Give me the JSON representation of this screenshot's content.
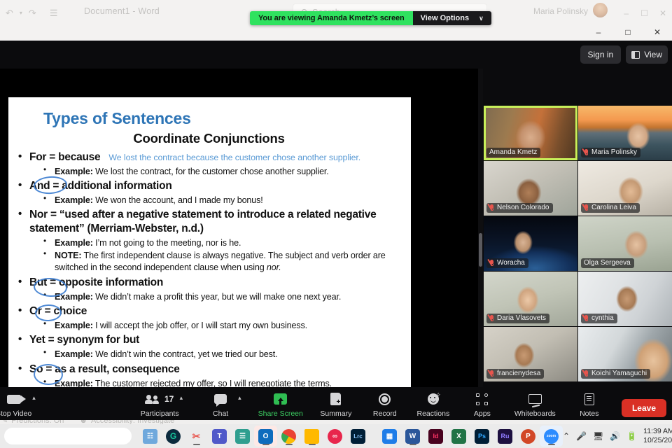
{
  "word": {
    "title": "Document1  -  Word",
    "search_placeholder": "Search",
    "account_name": "Maria Polinsky",
    "qat": [
      "undo-icon",
      "redo-icon",
      "save-icon",
      "ribbon-display-icon"
    ],
    "window_controls": {
      "minimize": "–",
      "maximize": "☐",
      "close": "✕"
    },
    "status": [
      {
        "icon": "predictions-icon",
        "label": "Predictions: On"
      },
      {
        "icon": "accessibility-icon",
        "label": "Accessibility: Investigate"
      }
    ]
  },
  "share_banner": {
    "message": "You are viewing Amanda Kmetz’s screen",
    "options_label": "View Options",
    "chevron": "∨",
    "green": "#2fe25f"
  },
  "zoom": {
    "window_controls": {
      "minimize": "–",
      "maximize": "□",
      "close": "✕"
    },
    "sign_in": "Sign in",
    "view_label": "View",
    "accent_green": "#3ccf62",
    "leave_red": "#d93025",
    "active_speaker_border": "#c8f05a"
  },
  "slide": {
    "title": "Types of Sentences",
    "subtitle": "Coordinate Conjunctions",
    "title_color": "#2e75b6",
    "items": [
      {
        "level": 1,
        "text": "For = because",
        "inline_note": "We lost the contract because the customer chose another supplier.",
        "circled": false
      },
      {
        "level": 2,
        "bold": "Example:",
        "text": " We lost the contract, for the customer chose another supplier."
      },
      {
        "level": 1,
        "text": "And = additional information",
        "circled": true
      },
      {
        "level": 2,
        "bold": "Example:",
        "text": " We won the account, and I made my bonus!"
      },
      {
        "level": 1,
        "text": "Nor = “used after a negative statement to introduce a related negative statement” (Merriam-Webster, n.d.)",
        "circled": false
      },
      {
        "level": 2,
        "bold": "Example:",
        "text": " I’m not going to the meeting, nor is he."
      },
      {
        "level": 2,
        "bold": "NOTE:",
        "text": " The first independent clause is always negative. The subject and verb order are switched in the second independent clause when using ",
        "italic_tail": "nor."
      },
      {
        "level": 1,
        "text": "But = opposite information",
        "circled": true
      },
      {
        "level": 2,
        "bold": "Example:",
        "text": " We didn’t make a profit this year, but we will make one next year."
      },
      {
        "level": 1,
        "text": "Or = choice",
        "circled": true
      },
      {
        "level": 2,
        "bold": "Example:",
        "text": " I will accept the job offer, or I will start my own business."
      },
      {
        "level": 1,
        "text": "Yet = synonym for but",
        "circled": false
      },
      {
        "level": 2,
        "bold": "Example:",
        "text": " We didn’t win the contract, yet we tried our best."
      },
      {
        "level": 1,
        "text": "So = as a result, consequence",
        "circled": true
      },
      {
        "level": 2,
        "bold": "Example:",
        "text": " The customer rejected my offer, so I will renegotiate the terms."
      }
    ]
  },
  "gallery": {
    "participants": [
      {
        "name": "Amanda Kmetz",
        "muted": false,
        "active_speaker": true
      },
      {
        "name": "Maria Polinsky",
        "muted": true,
        "active_speaker": false
      },
      {
        "name": "Nelson Colorado",
        "muted": true,
        "active_speaker": false
      },
      {
        "name": "Carolina Leiva",
        "muted": true,
        "active_speaker": false
      },
      {
        "name": "Woracha",
        "muted": true,
        "active_speaker": false
      },
      {
        "name": "Olga Sergeeva",
        "muted": false,
        "active_speaker": false
      },
      {
        "name": "Daria Vlasovets",
        "muted": true,
        "active_speaker": false
      },
      {
        "name": "cynthia",
        "muted": true,
        "active_speaker": false
      },
      {
        "name": "francienydesa",
        "muted": true,
        "active_speaker": false
      },
      {
        "name": "Koichi Yamaguchi",
        "muted": true,
        "active_speaker": false
      }
    ]
  },
  "toolbar": {
    "video_label": "Stop Video",
    "participants_label": "Participants",
    "participants_count": "17",
    "chat_label": "Chat",
    "share_label": "Share Screen",
    "summary_label": "Summary",
    "record_label": "Record",
    "reactions_label": "Reactions",
    "apps_label": "Apps",
    "whiteboards_label": "Whiteboards",
    "notes_label": "Notes",
    "leave_label": "Leave",
    "caret": "⌃"
  },
  "taskbar": {
    "search_placeholder": "",
    "apps": [
      {
        "name": "calculator",
        "glyph": "",
        "color": "#5b9bd5"
      },
      {
        "name": "grammarly",
        "glyph": "G",
        "color": "#15c39a"
      },
      {
        "name": "snipping-tool",
        "glyph": "",
        "color": "#e8554d"
      },
      {
        "name": "microsoft-teams",
        "glyph": "",
        "color": "#5059c9"
      },
      {
        "name": "sticky-notes",
        "glyph": "",
        "color": "#2f9e8f"
      },
      {
        "name": "outlook",
        "glyph": "O",
        "color": "#0f6cbd"
      },
      {
        "name": "google-chrome",
        "glyph": "",
        "color": "#4285f4"
      },
      {
        "name": "file-explorer",
        "glyph": "",
        "color": "#ffb900"
      },
      {
        "name": "nero",
        "glyph": "",
        "color": "#e8264c"
      },
      {
        "name": "lightroom-classic",
        "glyph": "Lrc",
        "color": "#001e36"
      },
      {
        "name": "trello",
        "glyph": "",
        "color": "#1f7de8"
      },
      {
        "name": "microsoft-word",
        "glyph": "W",
        "color": "#2b579a"
      },
      {
        "name": "indesign",
        "glyph": "Id",
        "color": "#49021f"
      },
      {
        "name": "microsoft-excel",
        "glyph": "X",
        "color": "#217346"
      },
      {
        "name": "photoshop",
        "glyph": "Ps",
        "color": "#001e36"
      },
      {
        "name": "rush",
        "glyph": "Ru",
        "color": "#1d1040"
      },
      {
        "name": "powerpoint",
        "glyph": "P",
        "color": "#d24726"
      },
      {
        "name": "zoom",
        "glyph": "zoom",
        "color": "#2d8cff"
      }
    ],
    "tray": {
      "chevron": "⌃",
      "mic": "mic-icon",
      "network": "network-icon",
      "volume": "volume-icon",
      "battery": "battery-icon",
      "time": "11:39 AM",
      "date": "10/25/202"
    }
  }
}
